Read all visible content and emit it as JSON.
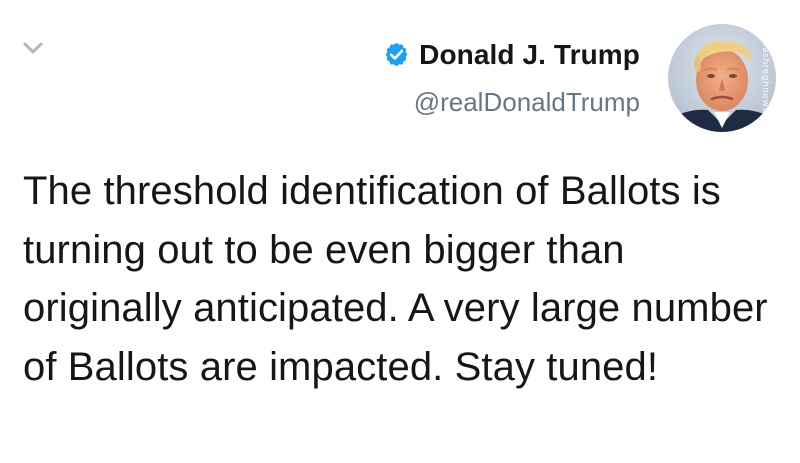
{
  "tweet": {
    "author": {
      "display_name": "Donald J. Trump",
      "handle": "@realDonaldTrump",
      "verified": true,
      "avatar_icon": "profile-photo",
      "watermark": "mashreghnews.ir"
    },
    "text": "The threshold identification of Ballots is turning out to be even bigger than originally anticipated. A very large number of Ballots are impacted. Stay tuned!",
    "menu_icon": "chevron-down-icon"
  },
  "colors": {
    "verified_badge": "#1da1f2",
    "text": "#14171a",
    "secondary_text": "#657786",
    "chevron": "#aab8c2"
  }
}
